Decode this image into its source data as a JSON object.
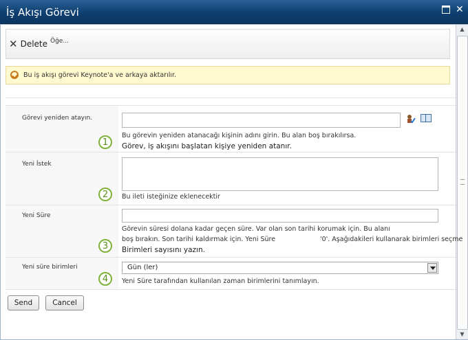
{
  "window": {
    "title": "İş Akışı Görevi"
  },
  "toolbar": {
    "delete_label": "Delete",
    "extra_label": "Öğe..."
  },
  "status": {
    "message": "Bu iş akışı görevi Keynote'a ve arkaya aktarılır."
  },
  "fields": {
    "reassign": {
      "label": "Görevi yeniden atayın.",
      "value": "",
      "desc1": "Bu görevin yeniden atanacağı kişinin adını girin. Bu alan boş bırakılırsa.",
      "desc2": "Görev, iş akışını başlatan kişiye yeniden atanır.",
      "marker": "1"
    },
    "request": {
      "label": "Yeni İstek",
      "value": "",
      "desc1": "Bu ileti isteğinize eklenecektir",
      "marker": "2"
    },
    "duration": {
      "label": "Yeni Süre",
      "value": "",
      "desc1": "Görevin süresi dolana kadar geçen süre. Var olan son tarihi korumak için. Bu alanı",
      "desc2a": "boş bırakın. Son tarihi kaldırmak için. Yeni Süre",
      "desc2b": "'0'. Aşağıdakileri kullanarak birimleri seçme",
      "desc3": "Birimleri sayısını yazın.",
      "marker": "3"
    },
    "units": {
      "label": "Yeni süre birimleri",
      "selected": "Gün (ler)",
      "desc1": "Yeni Süre tarafından kullanılan zaman birimlerini tanımlayın.",
      "marker": "4"
    }
  },
  "buttons": {
    "send": "Send",
    "cancel": "Cancel"
  },
  "colors": {
    "titlebar": "#0e3f70",
    "status_bg": "#fff9cf",
    "marker_green": "#7fb23a"
  }
}
